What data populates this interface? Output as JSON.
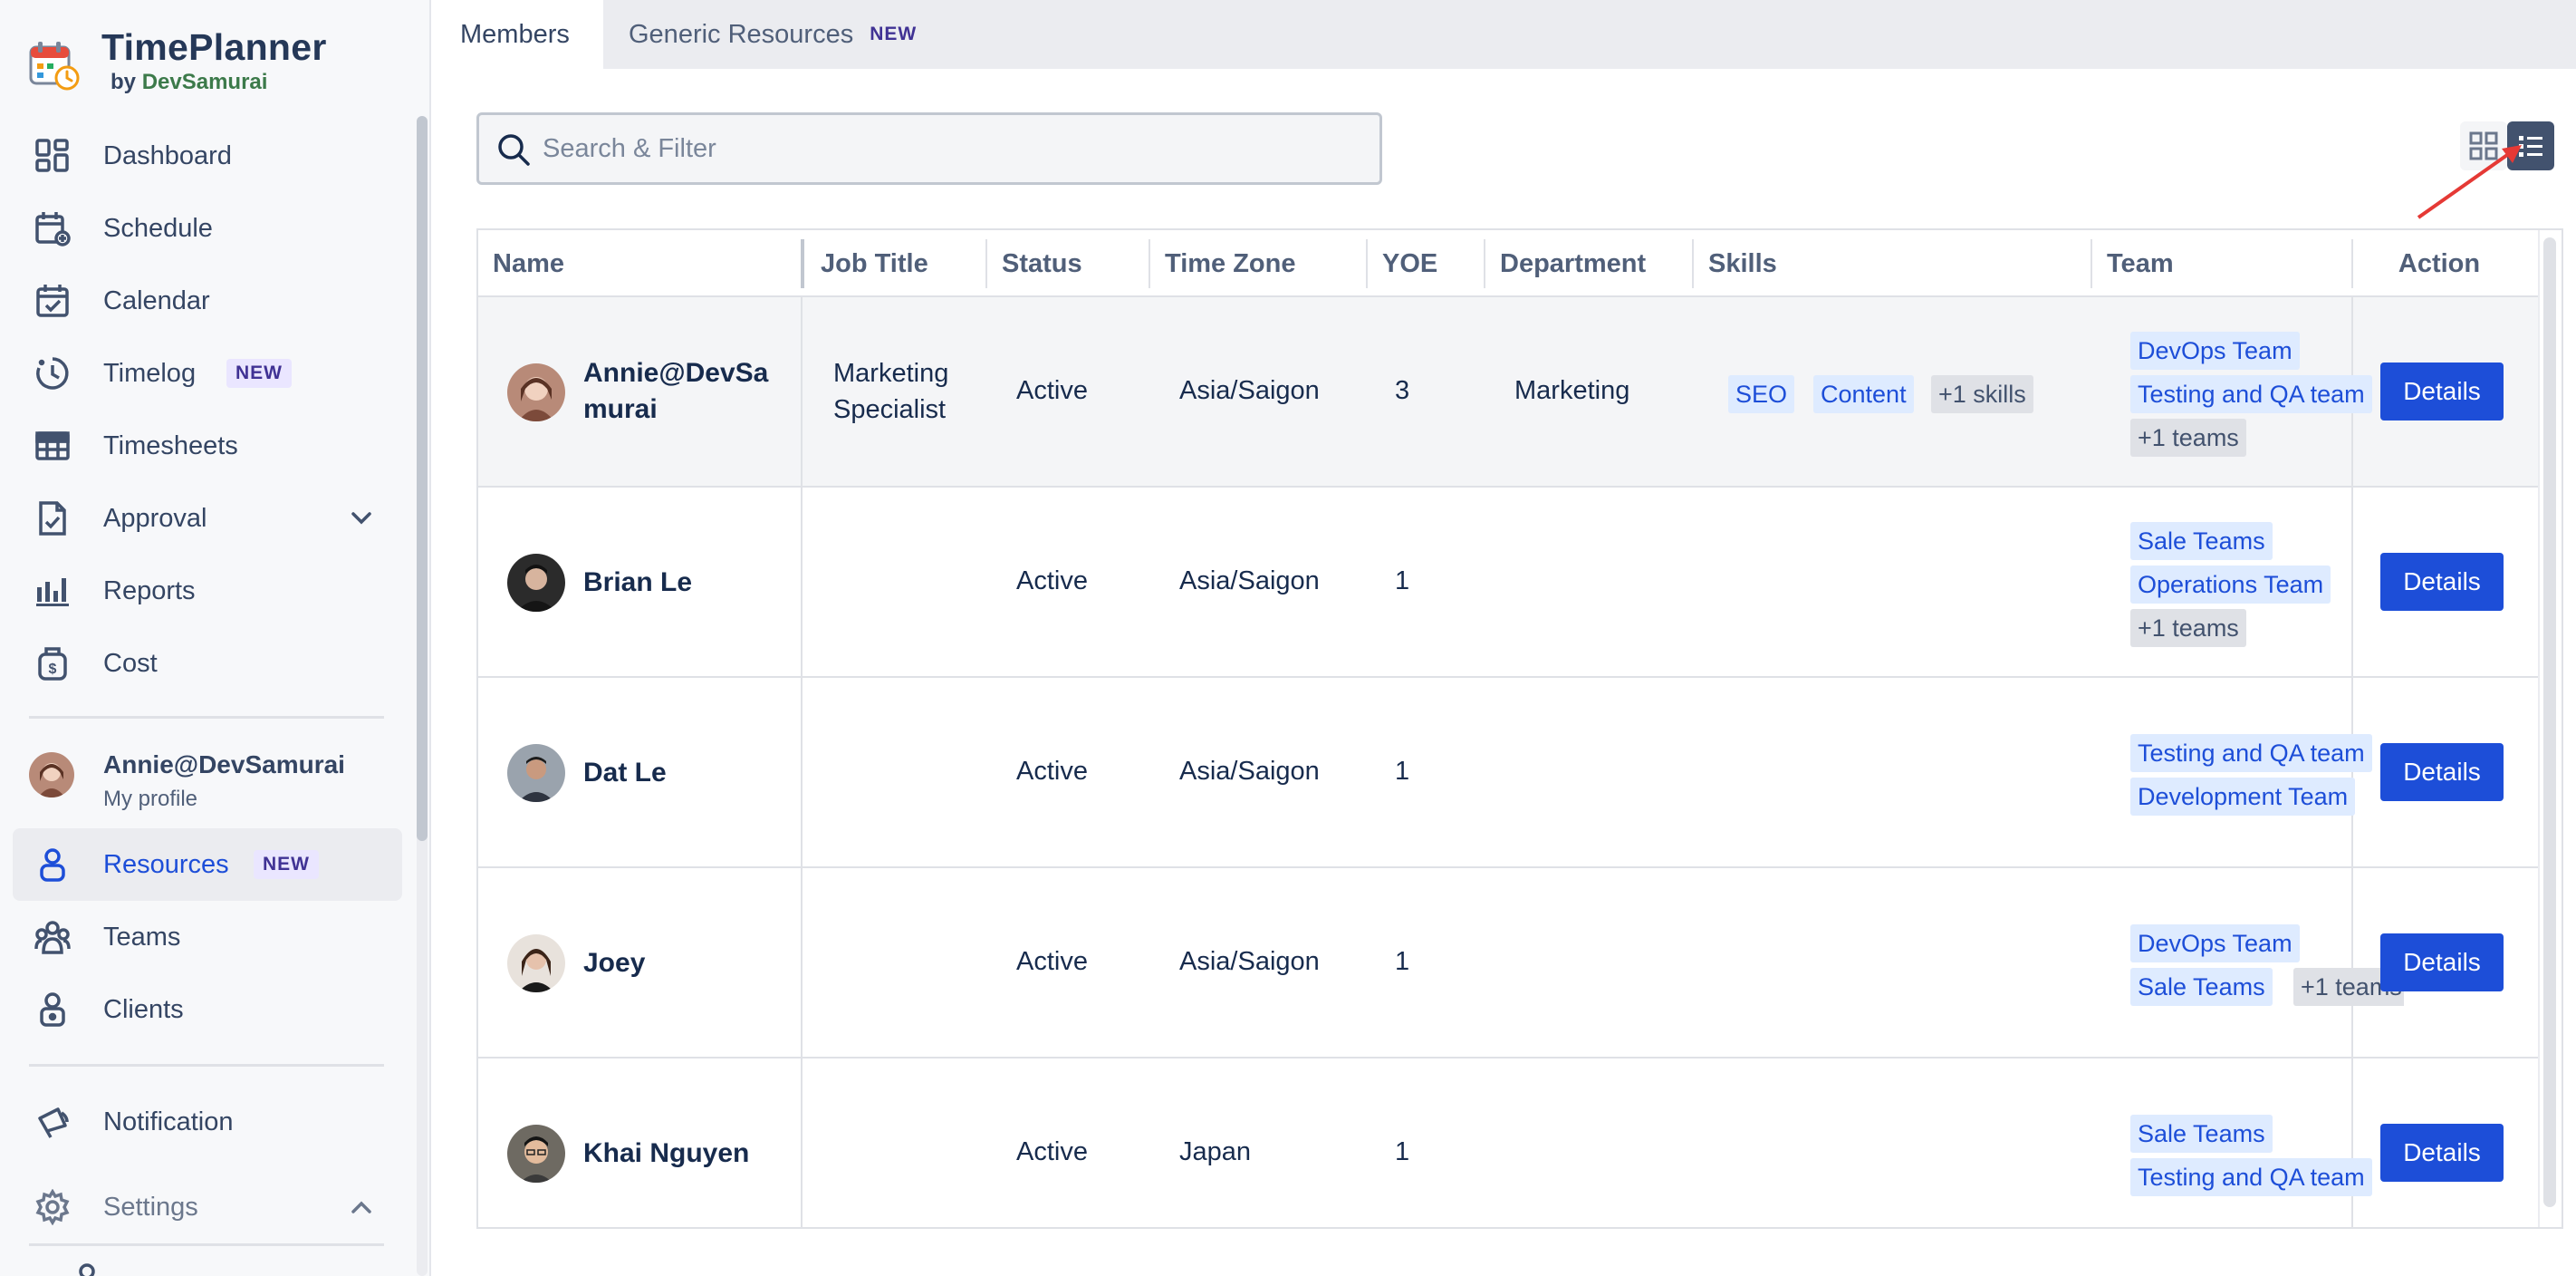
{
  "app": {
    "name": "TimePlanner",
    "by": "by",
    "org": "DevSamurai"
  },
  "sidebar": {
    "items": [
      {
        "label": "Dashboard"
      },
      {
        "label": "Schedule"
      },
      {
        "label": "Calendar"
      },
      {
        "label": "Timelog",
        "badge": "NEW"
      },
      {
        "label": "Timesheets"
      },
      {
        "label": "Approval"
      },
      {
        "label": "Reports"
      },
      {
        "label": "Cost"
      }
    ],
    "profile": {
      "name": "Annie@DevSamurai",
      "sub": "My profile"
    },
    "items2": [
      {
        "label": "Resources",
        "badge": "NEW"
      },
      {
        "label": "Teams"
      },
      {
        "label": "Clients"
      }
    ],
    "items3": [
      {
        "label": "Notification"
      },
      {
        "label": "Settings"
      }
    ]
  },
  "tabs": [
    {
      "label": "Members"
    },
    {
      "label": "Generic Resources",
      "badge": "NEW"
    }
  ],
  "search": {
    "placeholder": "Search & Filter"
  },
  "table": {
    "columns": [
      "Name",
      "Job Title",
      "Status",
      "Time Zone",
      "YOE",
      "Department",
      "Skills",
      "Team",
      "Action"
    ],
    "rows": [
      {
        "name1": "Annie@DevSa",
        "name2": "murai",
        "job1": "Marketing",
        "job2": "Specialist",
        "status": "Active",
        "tz": "Asia/Saigon",
        "yoe": "3",
        "dept": "Marketing",
        "skills": [
          "SEO",
          "Content"
        ],
        "skills_more": "+1 skills",
        "teams": [
          "DevOps Team",
          "Testing and QA team"
        ],
        "teams_more": "+1 teams",
        "action": "Details"
      },
      {
        "name": "Brian Le",
        "status": "Active",
        "tz": "Asia/Saigon",
        "yoe": "1",
        "teams": [
          "Sale Teams",
          "Operations Team"
        ],
        "teams_more": "+1 teams",
        "action": "Details"
      },
      {
        "name": "Dat Le",
        "status": "Active",
        "tz": "Asia/Saigon",
        "yoe": "1",
        "teams": [
          "Testing and QA team",
          "Development Team"
        ],
        "action": "Details"
      },
      {
        "name": "Joey",
        "status": "Active",
        "tz": "Asia/Saigon",
        "yoe": "1",
        "teams": [
          "DevOps Team",
          "Sale Teams"
        ],
        "teams_more": "+1 teams",
        "action": "Details"
      },
      {
        "name": "Khai Nguyen",
        "status": "Active",
        "tz": "Japan",
        "yoe": "1",
        "teams": [
          "Sale Teams",
          "Testing and QA team"
        ],
        "action": "Details"
      }
    ]
  },
  "colors": {
    "accent": "#1d4ed8",
    "badge_bg": "#eae6ff",
    "tag_bg": "#deebff",
    "annotation_arrow": "#e53935"
  }
}
